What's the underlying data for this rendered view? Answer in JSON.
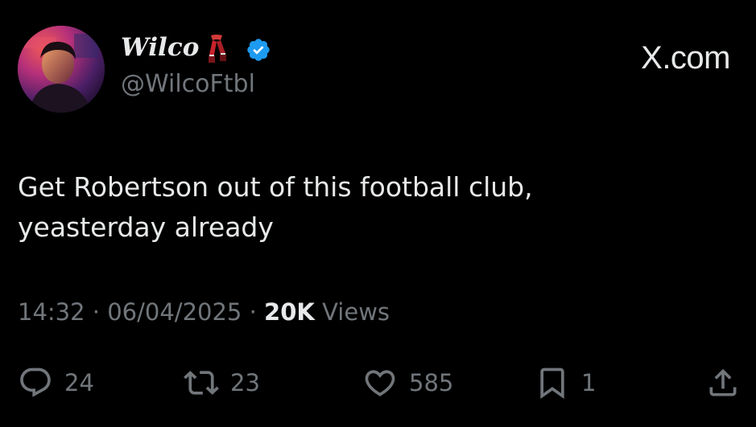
{
  "author": {
    "display_name": "Wilco",
    "handle": "@WilcoFtbl",
    "avatar_icon": "profile-photo",
    "badge_icons": [
      "scarf-icon",
      "verified-badge-icon"
    ],
    "verified_color": "#1d9bf0",
    "scarf_color": "#c8232c"
  },
  "brand": {
    "label": "X.com"
  },
  "tweet": {
    "lines": [
      "Get Robertson out of this football club,",
      "yeasterday already"
    ]
  },
  "meta": {
    "time": "14:32",
    "date": "06/04/2025",
    "views_count": "20K",
    "views_label": "Views",
    "separator": "·"
  },
  "actions": {
    "reply": {
      "icon": "reply-icon",
      "count": "24"
    },
    "repost": {
      "icon": "repost-icon",
      "count": "23"
    },
    "like": {
      "icon": "heart-icon",
      "count": "585"
    },
    "bookmark": {
      "icon": "bookmark-icon",
      "count": "1"
    },
    "share": {
      "icon": "share-icon"
    }
  },
  "colors": {
    "background": "#000000",
    "text": "#e7e9ea",
    "muted": "#71767b"
  }
}
